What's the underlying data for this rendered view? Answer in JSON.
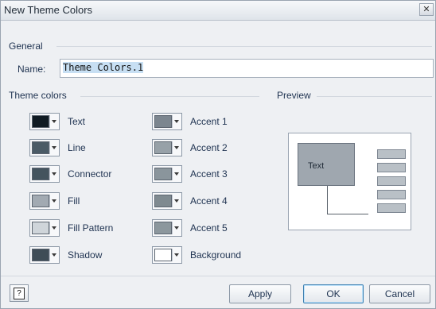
{
  "window": {
    "title": "New Theme Colors",
    "close_glyph": "✕"
  },
  "general": {
    "header": "General",
    "name_label": "Name:",
    "name_value": "Theme Colors.1"
  },
  "theme_colors": {
    "header": "Theme colors",
    "left": [
      {
        "label": "Text",
        "color": "#0f1a22"
      },
      {
        "label": "Line",
        "color": "#4b5b66"
      },
      {
        "label": "Connector",
        "color": "#44545e"
      },
      {
        "label": "Fill",
        "color": "#a2aab2"
      },
      {
        "label": "Fill Pattern",
        "color": "#cfd5da"
      },
      {
        "label": "Shadow",
        "color": "#3e4c56"
      }
    ],
    "right": [
      {
        "label": "Accent 1",
        "color": "#7c868f"
      },
      {
        "label": "Accent 2",
        "color": "#97a1a8"
      },
      {
        "label": "Accent 3",
        "color": "#8a959c"
      },
      {
        "label": "Accent 4",
        "color": "#7f8a90"
      },
      {
        "label": "Accent 5",
        "color": "#8c979d"
      },
      {
        "label": "Background",
        "color": "#ffffff"
      }
    ]
  },
  "preview": {
    "header": "Preview",
    "text": "Text"
  },
  "buttons": {
    "help_glyph": "?",
    "apply": "Apply",
    "ok": "OK",
    "cancel": "Cancel"
  }
}
